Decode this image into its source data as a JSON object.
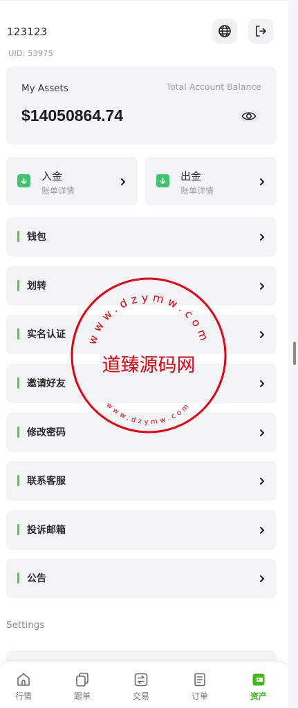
{
  "header": {
    "username": "123123",
    "uid": "UID: 53975",
    "globe_icon": "globe-icon",
    "logout_icon": "logout-icon"
  },
  "assets": {
    "title": "My Assets",
    "balance_label": "Total Account Balance",
    "balance": "$14050864.74",
    "eye_icon": "eye-icon"
  },
  "actions": [
    {
      "title": "入金",
      "subtitle": "账单详情",
      "icon": "deposit-arrow-icon"
    },
    {
      "title": "出金",
      "subtitle": "账单详情",
      "icon": "withdraw-arrow-icon"
    }
  ],
  "menu": [
    {
      "label": "钱包"
    },
    {
      "label": "划转"
    },
    {
      "label": "实名认证"
    },
    {
      "label": "邀请好友"
    },
    {
      "label": "修改密码"
    },
    {
      "label": "联系客服"
    },
    {
      "label": "投诉邮箱"
    },
    {
      "label": "公告"
    }
  ],
  "settings_label": "Settings",
  "tabs": [
    {
      "label": "行情",
      "icon": "home-icon"
    },
    {
      "label": "跟单",
      "icon": "copy-icon"
    },
    {
      "label": "交易",
      "icon": "exchange-icon"
    },
    {
      "label": "订单",
      "icon": "order-icon"
    },
    {
      "label": "资产",
      "icon": "wallet-icon",
      "active": true
    }
  ],
  "watermark": {
    "text": "道臻源码网",
    "url_top": "www.dzymw.com",
    "url_bottom": "www.dzymw.com"
  },
  "colors": {
    "accent": "#3fb91e",
    "menu_bar": "#5fc93e",
    "deposit_icon": "#3ec46d",
    "watermark": "#e60012"
  }
}
